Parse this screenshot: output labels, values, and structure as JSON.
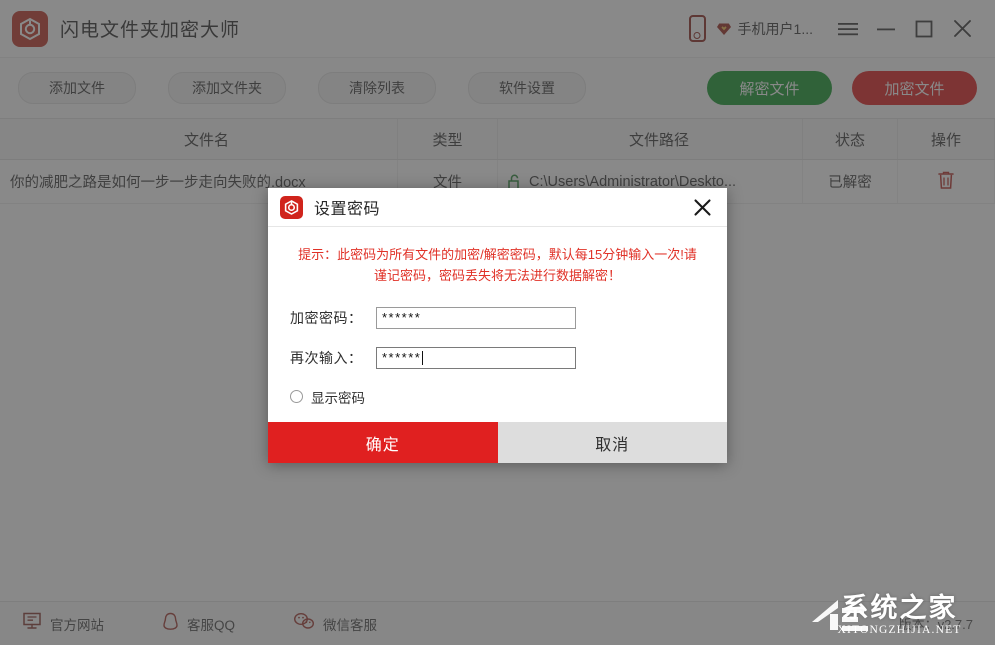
{
  "window": {
    "title": "闪电文件夹加密大师",
    "logo_icon": "app-shield-logo-icon",
    "phone_icon": "phone-icon",
    "vip_icon": "vip-diamond-icon",
    "user_name": "手机用户1...",
    "menu_icon": "hamburger-menu-icon",
    "minimize_icon": "minimize-icon",
    "maximize_icon": "maximize-icon",
    "close_icon": "close-icon"
  },
  "toolbar": {
    "add_file": "添加文件",
    "add_folder": "添加文件夹",
    "clear_list": "清除列表",
    "settings": "软件设置",
    "decrypt": "解密文件",
    "encrypt": "加密文件",
    "decrypt_color": "#15982d",
    "encrypt_color": "#e02020"
  },
  "table": {
    "headers": [
      "文件名",
      "类型",
      "文件路径",
      "状态",
      "操作"
    ],
    "rows": [
      {
        "name": "你的减肥之路是如何一步一步走向失败的.docx",
        "type": "文件",
        "path": "C:\\Users\\Administrator\\Deskto...",
        "path_icon": "unlocked-padlock-icon",
        "state": "已解密",
        "action_icon": "trash-icon"
      }
    ]
  },
  "footer": {
    "links": [
      {
        "label": "官方网站",
        "icon": "monitor-icon"
      },
      {
        "label": "客服QQ",
        "icon": "qq-penguin-icon"
      },
      {
        "label": "微信客服",
        "icon": "wechat-icon"
      }
    ],
    "version": "版本：v2.7.7"
  },
  "watermark": {
    "main": "系统之家",
    "sub": "XITONGZHIJIA.NET"
  },
  "dialog": {
    "title": "设置密码",
    "logo_icon": "app-shield-logo-icon",
    "close_icon": "close-icon",
    "warning": "提示：此密码为所有文件的加密/解密密码，默认每15分钟输入一次!请谨记密码，密码丢失将无法进行数据解密！",
    "warning_color": "#e03127",
    "password_label": "加密密码：",
    "password_value": "******",
    "confirm_label": "再次输入：",
    "confirm_value": "******",
    "show_password_label": "显示密码",
    "show_password_checked": false,
    "ok_label": "确定",
    "cancel_label": "取消"
  }
}
